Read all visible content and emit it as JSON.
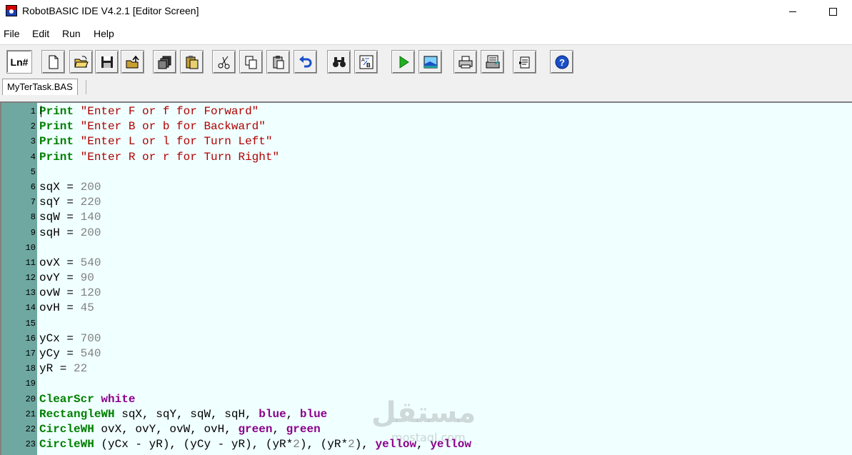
{
  "window": {
    "title": "RobotBASIC IDE V4.2.1 [Editor Screen]"
  },
  "menu": {
    "items": [
      "File",
      "Edit",
      "Run",
      "Help"
    ]
  },
  "toolbar": {
    "ln_label": "Ln#",
    "icons": [
      "new-file-icon",
      "open-folder-icon",
      "save-icon",
      "export-icon",
      "copy-files-icon",
      "paste-files-icon",
      "cut-icon",
      "copy-icon",
      "paste-icon",
      "undo-icon",
      "find-icon",
      "replace-icon",
      "run-icon",
      "terminal-screen-icon",
      "print-icon",
      "print-preview-icon",
      "notes-icon",
      "help-icon"
    ]
  },
  "tabs": [
    {
      "label": "MyTerTask.BAS"
    }
  ],
  "editor": {
    "lines": [
      {
        "n": "1",
        "tokens": [
          {
            "t": "Print",
            "c": "kw"
          },
          {
            "t": " "
          },
          {
            "t": "\"Enter F or f for Forward\"",
            "c": "str"
          }
        ]
      },
      {
        "n": "2",
        "tokens": [
          {
            "t": "Print",
            "c": "kw"
          },
          {
            "t": " "
          },
          {
            "t": "\"Enter B or b for Backward\"",
            "c": "str"
          }
        ]
      },
      {
        "n": "3",
        "tokens": [
          {
            "t": "Print",
            "c": "kw"
          },
          {
            "t": " "
          },
          {
            "t": "\"Enter L or l for Turn Left\"",
            "c": "str"
          }
        ]
      },
      {
        "n": "4",
        "tokens": [
          {
            "t": "Print",
            "c": "kw"
          },
          {
            "t": " "
          },
          {
            "t": "\"Enter R or r for Turn Right\"",
            "c": "str"
          }
        ]
      },
      {
        "n": "5",
        "tokens": []
      },
      {
        "n": "6",
        "tokens": [
          {
            "t": "sqX = "
          },
          {
            "t": "200",
            "c": "num"
          }
        ]
      },
      {
        "n": "7",
        "tokens": [
          {
            "t": "sqY = "
          },
          {
            "t": "220",
            "c": "num"
          }
        ]
      },
      {
        "n": "8",
        "tokens": [
          {
            "t": "sqW = "
          },
          {
            "t": "140",
            "c": "num"
          }
        ]
      },
      {
        "n": "9",
        "tokens": [
          {
            "t": "sqH = "
          },
          {
            "t": "200",
            "c": "num"
          }
        ]
      },
      {
        "n": "10",
        "tokens": []
      },
      {
        "n": "11",
        "tokens": [
          {
            "t": "ovX = "
          },
          {
            "t": "540",
            "c": "num"
          }
        ]
      },
      {
        "n": "12",
        "tokens": [
          {
            "t": "ovY = "
          },
          {
            "t": "90",
            "c": "num"
          }
        ]
      },
      {
        "n": "13",
        "tokens": [
          {
            "t": "ovW = "
          },
          {
            "t": "120",
            "c": "num"
          }
        ]
      },
      {
        "n": "14",
        "tokens": [
          {
            "t": "ovH = "
          },
          {
            "t": "45",
            "c": "num"
          }
        ]
      },
      {
        "n": "15",
        "tokens": []
      },
      {
        "n": "16",
        "tokens": [
          {
            "t": "yCx = "
          },
          {
            "t": "700",
            "c": "num"
          }
        ]
      },
      {
        "n": "17",
        "tokens": [
          {
            "t": "yCy = "
          },
          {
            "t": "540",
            "c": "num"
          }
        ]
      },
      {
        "n": "18",
        "tokens": [
          {
            "t": "yR = "
          },
          {
            "t": "22",
            "c": "num"
          }
        ]
      },
      {
        "n": "19",
        "tokens": []
      },
      {
        "n": "20",
        "tokens": [
          {
            "t": "ClearScr",
            "c": "kw"
          },
          {
            "t": " "
          },
          {
            "t": "white",
            "c": "col"
          }
        ]
      },
      {
        "n": "21",
        "tokens": [
          {
            "t": "RectangleWH",
            "c": "kw"
          },
          {
            "t": " sqX, sqY, sqW, sqH, "
          },
          {
            "t": "blue",
            "c": "col"
          },
          {
            "t": ", "
          },
          {
            "t": "blue",
            "c": "col"
          }
        ]
      },
      {
        "n": "22",
        "tokens": [
          {
            "t": "CircleWH",
            "c": "kw"
          },
          {
            "t": " ovX, ovY, ovW, ovH, "
          },
          {
            "t": "green",
            "c": "col"
          },
          {
            "t": ", "
          },
          {
            "t": "green",
            "c": "col"
          }
        ]
      },
      {
        "n": "23",
        "tokens": [
          {
            "t": "CircleWH",
            "c": "kw"
          },
          {
            "t": " (yCx - yR), (yCy - yR), (yR*"
          },
          {
            "t": "2",
            "c": "num"
          },
          {
            "t": "), (yR*"
          },
          {
            "t": "2",
            "c": "num"
          },
          {
            "t": "), "
          },
          {
            "t": "yellow",
            "c": "col"
          },
          {
            "t": ", "
          },
          {
            "t": "yellow",
            "c": "col"
          }
        ]
      }
    ]
  },
  "watermark": {
    "text": "مستقل",
    "subtext": "mostaql.com"
  },
  "colors": {
    "keyword": "#008000",
    "string": "#b00000",
    "number": "#808080",
    "color_const": "#8b008b",
    "gutter": "#6fa8a0",
    "editor_bg": "#f0ffff"
  }
}
